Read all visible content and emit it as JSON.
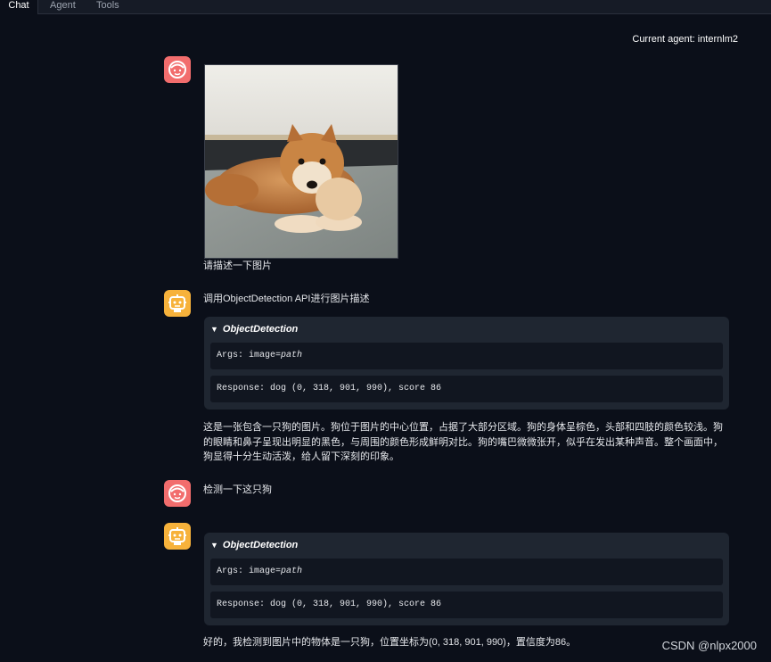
{
  "tabs": [
    {
      "label": "Chat"
    },
    {
      "label": "Agent"
    },
    {
      "label": "Tools"
    }
  ],
  "agent_label": "Current agent: internlm2",
  "messages": {
    "user1": {
      "text": "请描述一下图片",
      "image_alt": "shiba inu dog photo"
    },
    "bot1": {
      "intro": "调用ObjectDetection API进行图片描述",
      "tool_name": "ObjectDetection",
      "args_label": "Args: image=",
      "args_value": "path",
      "response": "Response: dog (0, 318, 901, 990), score 86",
      "reply": "这是一张包含一只狗的图片。狗位于图片的中心位置，占据了大部分区域。狗的身体呈棕色，头部和四肢的颜色较浅。狗的眼睛和鼻子呈现出明显的黑色，与周围的颜色形成鲜明对比。狗的嘴巴微微张开，似乎在发出某种声音。整个画面中，狗显得十分生动活泼，给人留下深刻的印象。"
    },
    "user2": {
      "text": "检测一下这只狗"
    },
    "bot2": {
      "tool_name": "ObjectDetection",
      "args_label": "Args: image=",
      "args_value": "path",
      "response": "Response: dog (0, 318, 901, 990), score 86",
      "reply": "好的，我检测到图片中的物体是一只狗，位置坐标为(0, 318, 901, 990)，置信度为86。"
    }
  },
  "watermark": "CSDN @nlpx2000",
  "colors": {
    "background": "#0b0f19",
    "user_avatar": "#f26d6d",
    "bot_avatar": "#f7b23b",
    "tool_card": "#1f2631",
    "code_row": "#111620"
  },
  "icons": {
    "user_avatar": "face-icon",
    "bot_avatar": "robot-icon",
    "collapse": "triangle-down-icon"
  }
}
